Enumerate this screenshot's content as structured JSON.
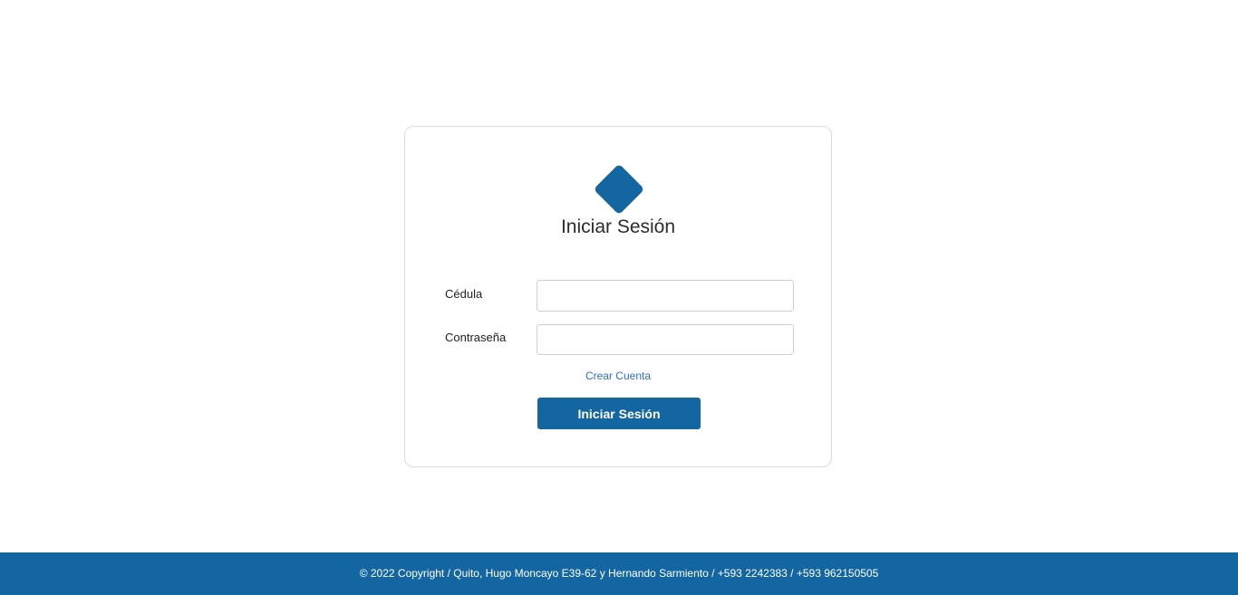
{
  "login": {
    "title": "Iniciar Sesión",
    "cedula_label": "Cédula",
    "cedula_value": "",
    "password_label": "Contraseña",
    "password_value": "",
    "create_account_link": "Crear Cuenta",
    "submit_label": "Iniciar Sesión",
    "logo_icon": "diamond-logo-icon"
  },
  "footer": {
    "text": "© 2022 Copyright / Quito, Hugo Moncayo E39-62 y Hernando Sarmiento / +593 2242383 / +593 962150505"
  },
  "colors": {
    "brand": "#1366a1",
    "link": "#2a6fd6",
    "border": "#dcdcdc"
  }
}
